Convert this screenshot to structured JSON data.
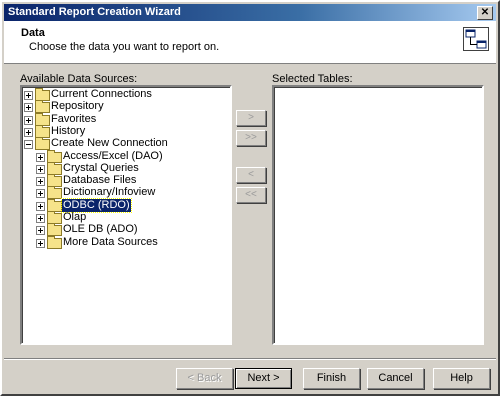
{
  "window": {
    "title": "Standard Report Creation Wizard",
    "close_glyph": "✕"
  },
  "header": {
    "title": "Data",
    "subtitle": "Choose the data you want to report on.",
    "icon": "table-link-icon"
  },
  "available": {
    "label": "Available Data Sources:",
    "items": [
      {
        "label": "Current Connections",
        "level": 0,
        "expander": "plus"
      },
      {
        "label": "Repository",
        "level": 0,
        "expander": "plus"
      },
      {
        "label": "Favorites",
        "level": 0,
        "expander": "plus"
      },
      {
        "label": "History",
        "level": 0,
        "expander": "plus"
      },
      {
        "label": "Create New Connection",
        "level": 0,
        "expander": "minus"
      },
      {
        "label": "Access/Excel (DAO)",
        "level": 1,
        "expander": "plus"
      },
      {
        "label": "Crystal Queries",
        "level": 1,
        "expander": "plus"
      },
      {
        "label": "Database Files",
        "level": 1,
        "expander": "plus"
      },
      {
        "label": "Dictionary/Infoview",
        "level": 1,
        "expander": "plus"
      },
      {
        "label": "ODBC (RDO)",
        "level": 1,
        "expander": "plus",
        "selected": true
      },
      {
        "label": "Olap",
        "level": 1,
        "expander": "plus"
      },
      {
        "label": "OLE DB (ADO)",
        "level": 1,
        "expander": "plus"
      },
      {
        "label": "More Data Sources",
        "level": 1,
        "expander": "plus"
      }
    ]
  },
  "selected_tables": {
    "label": "Selected Tables:"
  },
  "transfer": {
    "add": ">",
    "add_all": ">>",
    "remove": "<",
    "remove_all": "<<"
  },
  "footer": {
    "back": "< Back",
    "next": "Next >",
    "finish": "Finish",
    "cancel": "Cancel",
    "help": "Help"
  }
}
